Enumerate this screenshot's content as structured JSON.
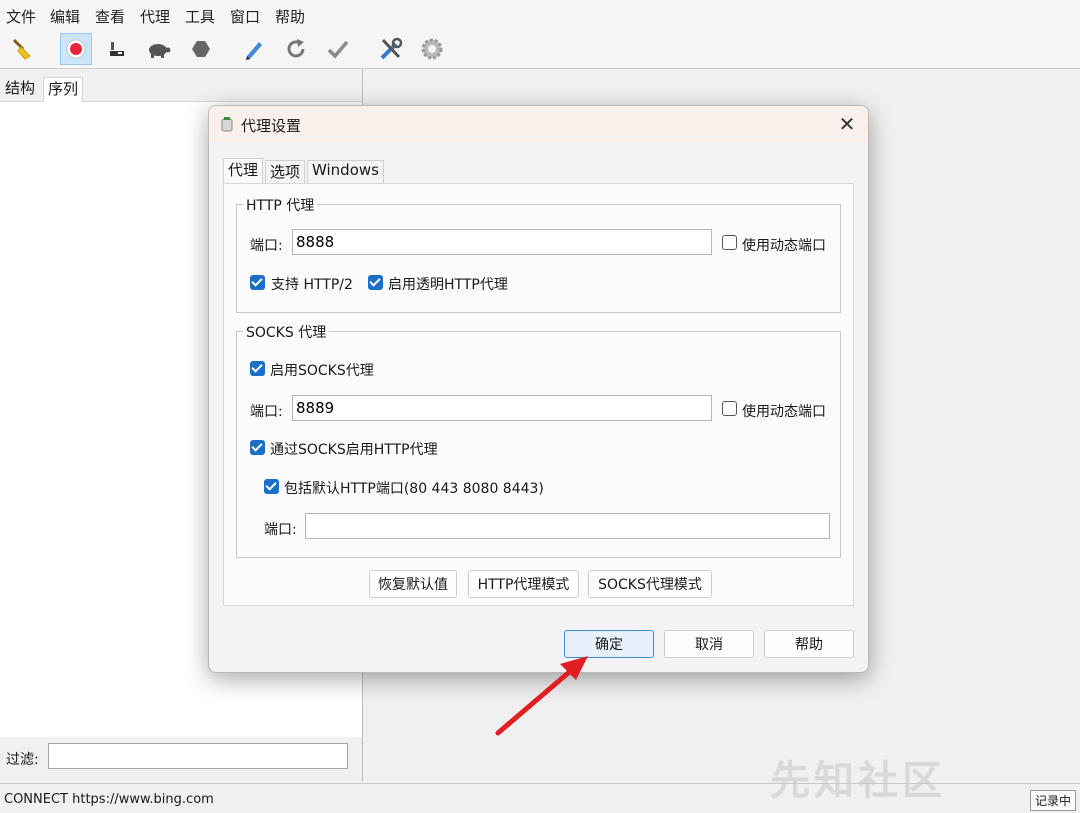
{
  "menu": [
    "文件",
    "编辑",
    "查看",
    "代理",
    "工具",
    "窗口",
    "帮助"
  ],
  "toolbar_icons": [
    "broom-icon",
    "record-icon",
    "throttle-icon",
    "turtle-icon",
    "stop-hexagon-icon",
    "pen-icon",
    "refresh-icon",
    "check-icon",
    "tools-icon",
    "settings-icon"
  ],
  "left_panel": {
    "tabs": [
      "结构",
      "序列"
    ],
    "filter_label": "过滤:",
    "filter_value": ""
  },
  "status": {
    "text": "CONNECT https://www.bing.com",
    "badge": "记录中"
  },
  "watermark": "先知社区",
  "dialog": {
    "title": "代理设置",
    "tabs": [
      "代理",
      "选项",
      "Windows"
    ],
    "http_group": {
      "title": "HTTP 代理",
      "port_label": "端口:",
      "port_value": "8888",
      "dynamic_port_label": "使用动态端口",
      "dynamic_port_checked": false,
      "http2_label": "支持 HTTP/2",
      "http2_checked": true,
      "transparent_label": "启用透明HTTP代理",
      "transparent_checked": true
    },
    "socks_group": {
      "title": "SOCKS 代理",
      "enable_label": "启用SOCKS代理",
      "enable_checked": true,
      "port_label": "端口:",
      "port_value": "8889",
      "dynamic_port_label": "使用动态端口",
      "dynamic_port_checked": false,
      "http_via_socks_label": "通过SOCKS启用HTTP代理",
      "http_via_socks_checked": true,
      "default_ports_label": "包括默认HTTP端口(80 443 8080 8443)",
      "default_ports_checked": true,
      "extra_port_label": "端口:",
      "extra_port_value": ""
    },
    "buttons": {
      "restore_defaults": "恢复默认值",
      "http_mode": "HTTP代理模式",
      "socks_mode": "SOCKS代理模式",
      "ok": "确定",
      "cancel": "取消",
      "help": "帮助"
    }
  },
  "colors": {
    "accent": "#1a6fc9",
    "arrow": "#e02020",
    "title_bar": "#faf0eb"
  }
}
